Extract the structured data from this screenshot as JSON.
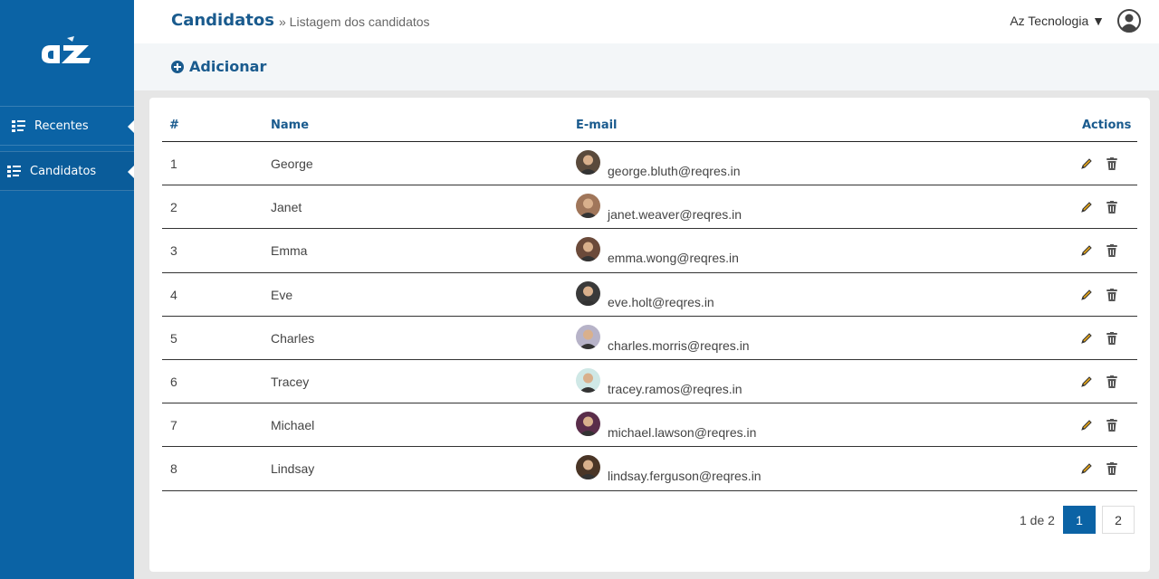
{
  "sidebar": {
    "items": [
      {
        "label": "Recentes"
      },
      {
        "label": "Candidatos"
      }
    ]
  },
  "header": {
    "title": "Candidatos",
    "breadcrumb": "» Listagem dos candidatos",
    "company": "Az Tecnologia ▼"
  },
  "actions": {
    "add_label": "Adicionar"
  },
  "table": {
    "columns": [
      "#",
      "Name",
      "E-mail",
      "Actions"
    ],
    "rows": [
      {
        "id": "1",
        "name": "George",
        "email": "george.bluth@reqres.in",
        "avatar_color": "#5a4a3c"
      },
      {
        "id": "2",
        "name": "Janet",
        "email": "janet.weaver@reqres.in",
        "avatar_color": "#a0765a"
      },
      {
        "id": "3",
        "name": "Emma",
        "email": "emma.wong@reqres.in",
        "avatar_color": "#6b4a3a"
      },
      {
        "id": "4",
        "name": "Eve",
        "email": "eve.holt@reqres.in",
        "avatar_color": "#3a3a3a"
      },
      {
        "id": "5",
        "name": "Charles",
        "email": "charles.morris@reqres.in",
        "avatar_color": "#b7b3c8"
      },
      {
        "id": "6",
        "name": "Tracey",
        "email": "tracey.ramos@reqres.in",
        "avatar_color": "#cfe8e6"
      },
      {
        "id": "7",
        "name": "Michael",
        "email": "michael.lawson@reqres.in",
        "avatar_color": "#5a2d4a"
      },
      {
        "id": "8",
        "name": "Lindsay",
        "email": "lindsay.ferguson@reqres.in",
        "avatar_color": "#4a3526"
      }
    ]
  },
  "pagination": {
    "info": "1 de 2",
    "pages": [
      "1",
      "2"
    ],
    "current": "1"
  },
  "colors": {
    "brand": "#0b63a5",
    "title": "#1a5b8e",
    "edit_icon": "#e0a21a",
    "delete_icon": "#555555"
  }
}
